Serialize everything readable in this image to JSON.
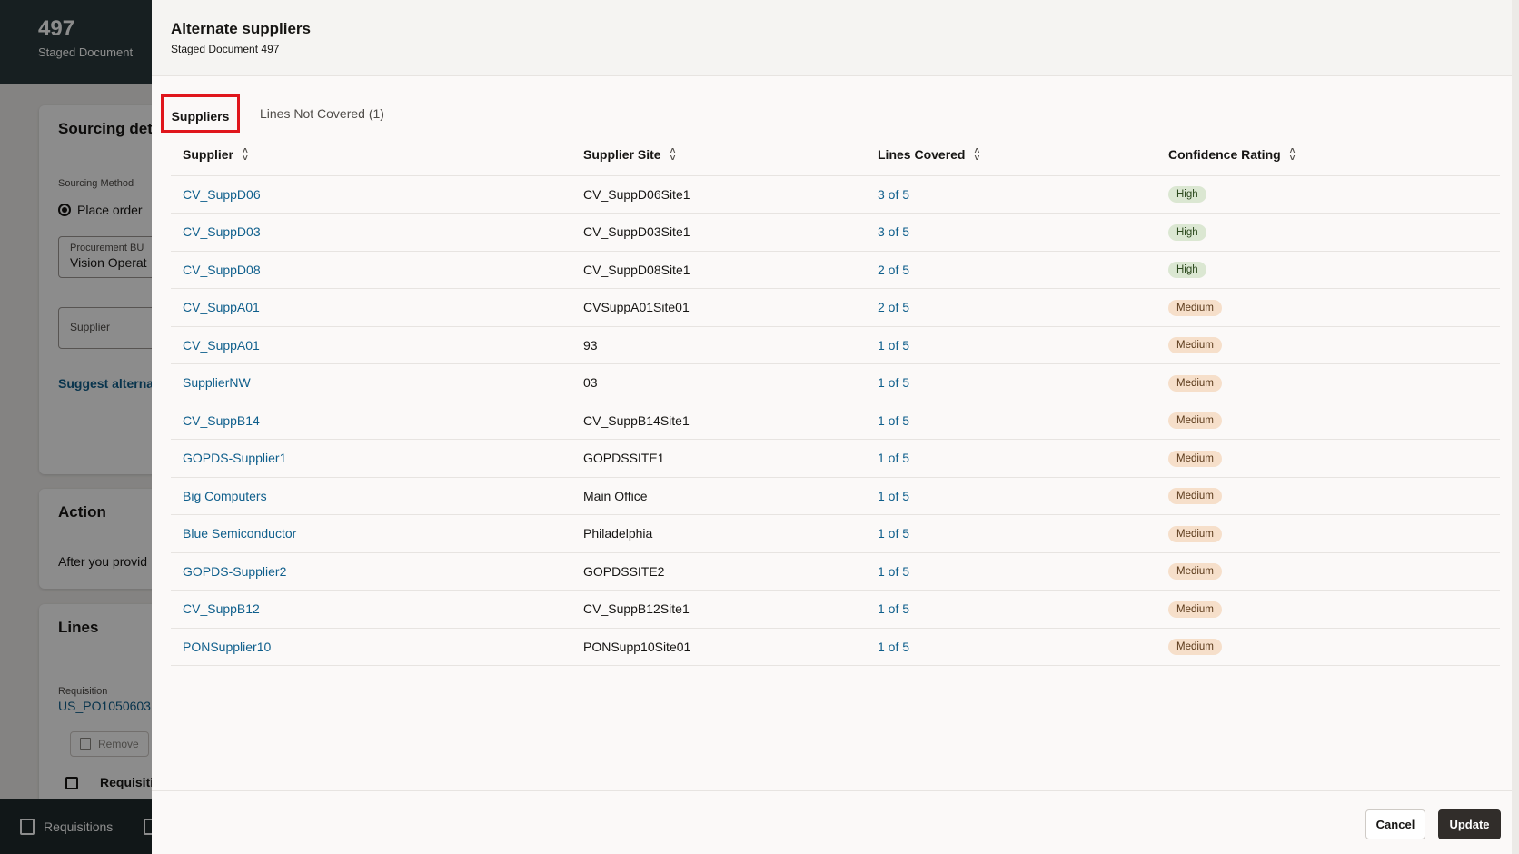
{
  "background": {
    "header_number": "497",
    "header_subtitle": "Staged Document",
    "sourcing_title": "Sourcing det",
    "sourcing_method_label": "Sourcing Method",
    "place_order_label": "Place order",
    "procurement_bu_label": "Procurement BU",
    "procurement_bu_value": "Vision Operat",
    "supplier_placeholder": "Supplier",
    "suggest_link": "Suggest alterna",
    "action_title": "Action",
    "action_text": "After you provid",
    "lines_title": "Lines",
    "requisition_label": "Requisition",
    "requisition_value": "US_PO1050603",
    "remove_button": "Remove",
    "requisition_col": "Requisiti",
    "footer_requisitions": "Requisitions"
  },
  "drawer": {
    "title": "Alternate suppliers",
    "subtitle": "Staged Document 497",
    "tabs": [
      {
        "label": "Suppliers",
        "selected": true
      },
      {
        "label": "Lines Not Covered (1)",
        "selected": false
      }
    ],
    "columns": [
      "Supplier",
      "Supplier Site",
      "Lines Covered",
      "Confidence Rating"
    ],
    "rows": [
      {
        "supplier": "CV_SuppD06",
        "site": "CV_SuppD06Site1",
        "lines": "3 of 5",
        "rating": "High"
      },
      {
        "supplier": "CV_SuppD03",
        "site": "CV_SuppD03Site1",
        "lines": "3 of 5",
        "rating": "High"
      },
      {
        "supplier": "CV_SuppD08",
        "site": "CV_SuppD08Site1",
        "lines": "2 of 5",
        "rating": "High"
      },
      {
        "supplier": "CV_SuppA01",
        "site": "CVSuppA01Site01",
        "lines": "2 of 5",
        "rating": "Medium"
      },
      {
        "supplier": "CV_SuppA01",
        "site": "93",
        "lines": "1 of 5",
        "rating": "Medium"
      },
      {
        "supplier": "SupplierNW",
        "site": "03",
        "lines": "1 of 5",
        "rating": "Medium"
      },
      {
        "supplier": "CV_SuppB14",
        "site": "CV_SuppB14Site1",
        "lines": "1 of 5",
        "rating": "Medium"
      },
      {
        "supplier": "GOPDS-Supplier1",
        "site": "GOPDSSITE1",
        "lines": "1 of 5",
        "rating": "Medium"
      },
      {
        "supplier": "Big Computers",
        "site": "Main Office",
        "lines": "1 of 5",
        "rating": "Medium"
      },
      {
        "supplier": "Blue Semiconductor",
        "site": "Philadelphia",
        "lines": "1 of 5",
        "rating": "Medium"
      },
      {
        "supplier": "GOPDS-Supplier2",
        "site": "GOPDSSITE2",
        "lines": "1 of 5",
        "rating": "Medium"
      },
      {
        "supplier": "CV_SuppB12",
        "site": "CV_SuppB12Site1",
        "lines": "1 of 5",
        "rating": "Medium"
      },
      {
        "supplier": "PONSupplier10",
        "site": "PONSupp10Site01",
        "lines": "1 of 5",
        "rating": "Medium"
      }
    ],
    "cancel_label": "Cancel",
    "update_label": "Update"
  }
}
